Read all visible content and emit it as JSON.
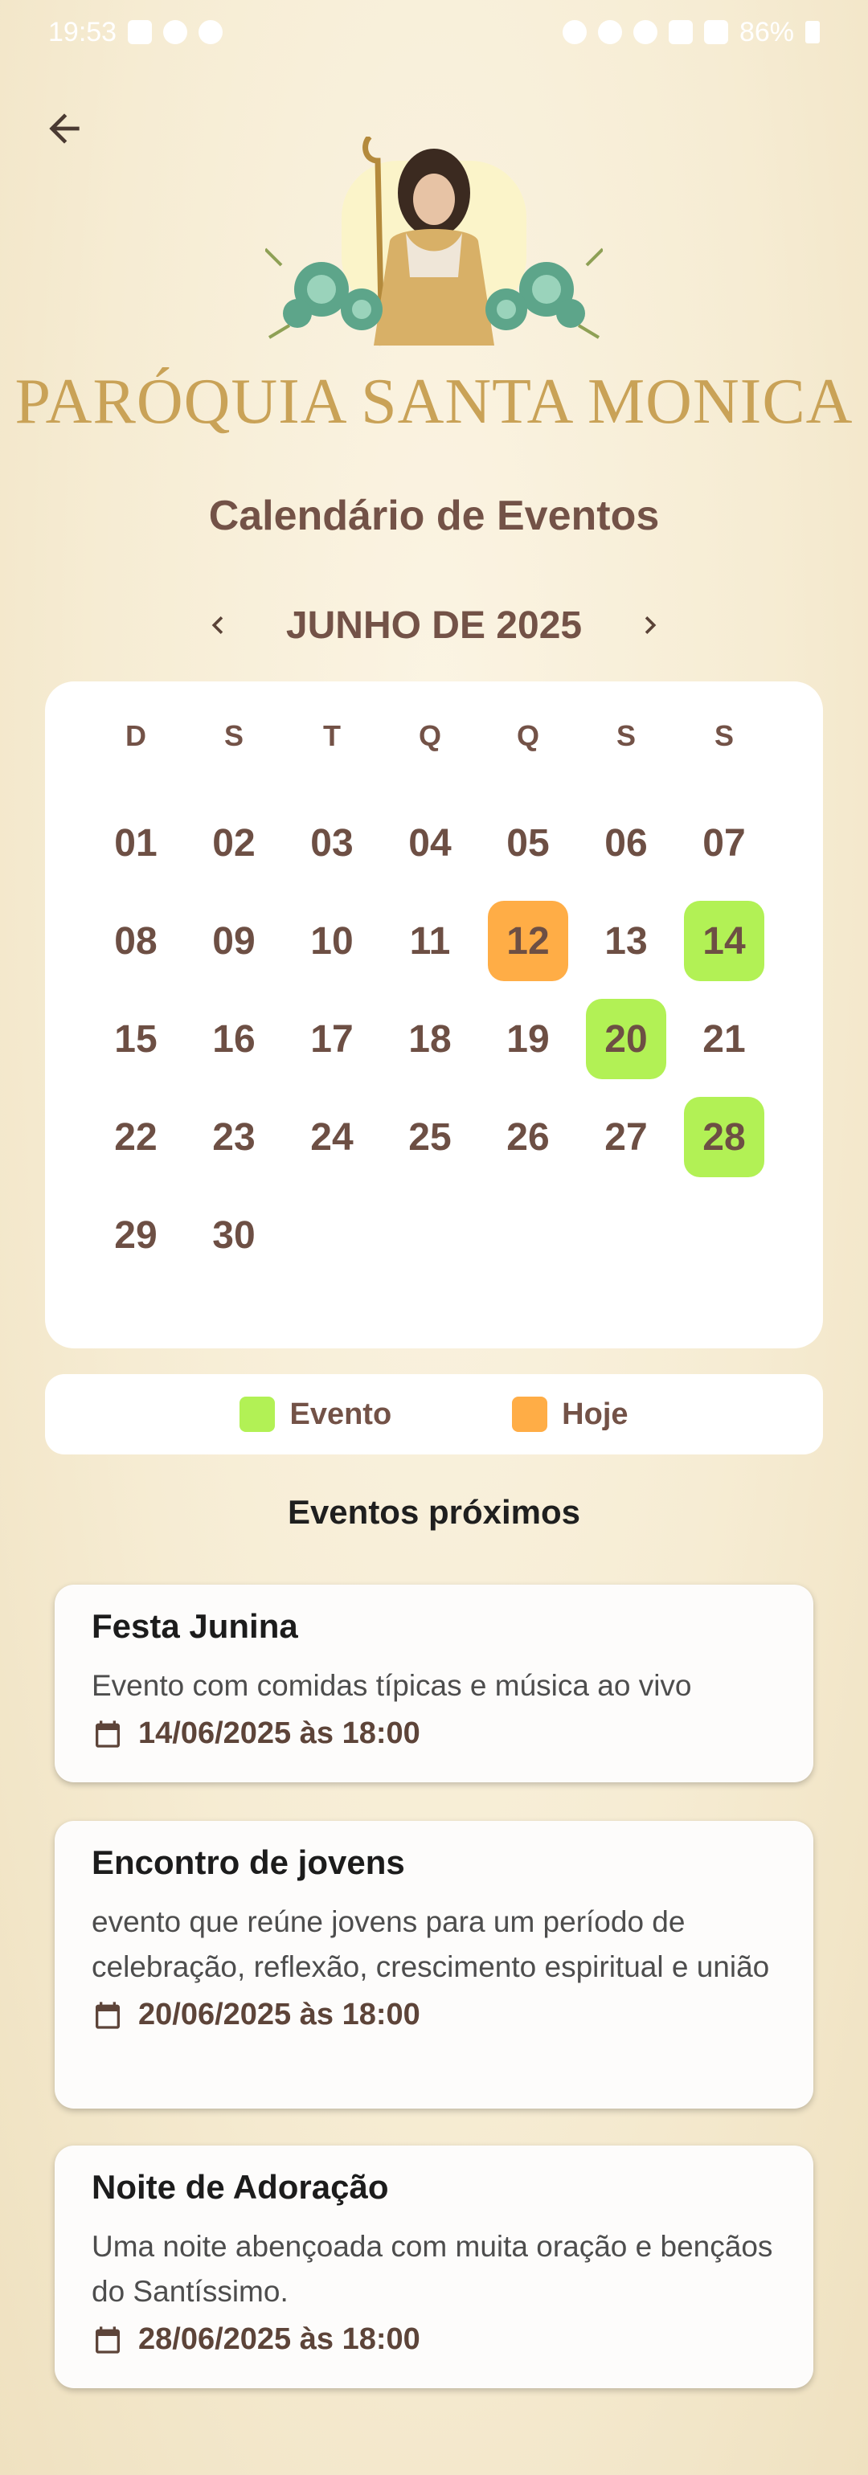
{
  "status_bar": {
    "time": "19:53",
    "battery": "86%"
  },
  "header": {
    "parish_name": "PARÓQUIA SANTA MONICA"
  },
  "page": {
    "title": "Calendário de Eventos"
  },
  "calendar": {
    "month_label": "JUNHO DE 2025",
    "weekdays": [
      "D",
      "S",
      "T",
      "Q",
      "Q",
      "S",
      "S"
    ],
    "days": [
      "01",
      "02",
      "03",
      "04",
      "05",
      "06",
      "07",
      "08",
      "09",
      "10",
      "11",
      "12",
      "13",
      "14",
      "15",
      "16",
      "17",
      "18",
      "19",
      "20",
      "21",
      "22",
      "23",
      "24",
      "25",
      "26",
      "27",
      "28",
      "29",
      "30"
    ],
    "today": "12",
    "event_days": [
      "14",
      "20",
      "28"
    ]
  },
  "legend": {
    "event_label": "Evento",
    "today_label": "Hoje",
    "event_color": "#b2f155",
    "today_color": "#ffad46"
  },
  "upcoming": {
    "title": "Eventos próximos",
    "events": [
      {
        "title": "Festa Junina",
        "description": "Evento com comidas típicas e música ao vivo",
        "datetime": "14/06/2025 às 18:00"
      },
      {
        "title": "Encontro de jovens",
        "description": "evento que reúne jovens para um período de celebração, reflexão, crescimento espiritual e união",
        "datetime": "20/06/2025 às 18:00"
      },
      {
        "title": "Noite de Adoração",
        "description": "Uma noite abençoada com muita oração e bençãos do Santíssimo.",
        "datetime": "28/06/2025 às 18:00"
      }
    ]
  }
}
